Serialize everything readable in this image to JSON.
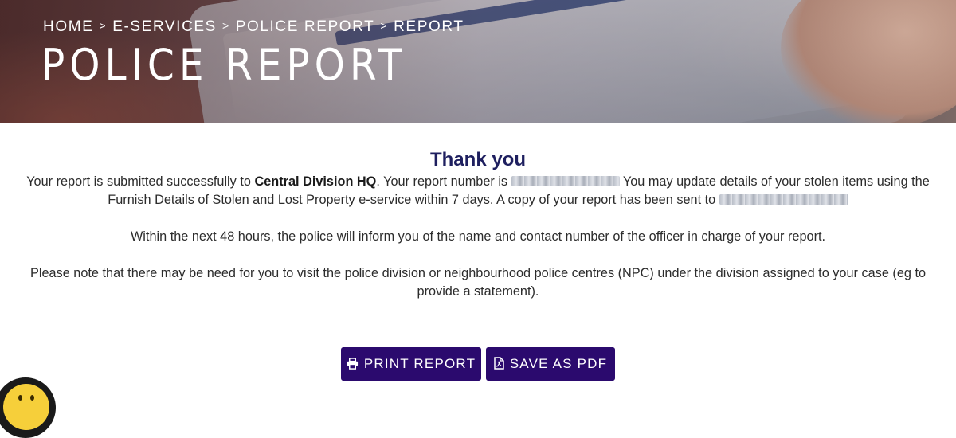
{
  "hero": {
    "breadcrumb": [
      {
        "label": "HOME"
      },
      {
        "label": "E-SERVICES"
      },
      {
        "label": "POLICE REPORT"
      },
      {
        "label": "REPORT"
      }
    ],
    "separator": ">",
    "title": "POLICE REPORT"
  },
  "confirmation": {
    "heading": "Thank you",
    "p1": {
      "lead": "Your report is submitted successfully to ",
      "division": "Central Division HQ",
      "mid": ". Your report number is ",
      "after_number": " You may update details of your stolen items using the Furnish Details of Stolen and Lost Property e-service within 7 days. A copy of your report has been sent to "
    },
    "p2": "Within the next 48 hours, the police will inform you of the name and contact number of the officer in charge of your report.",
    "p3": "Please note that there may be need for you to visit the police division or neighbourhood police centres (NPC) under the division assigned to your case (eg to provide a statement)."
  },
  "actions": {
    "print_label": "PRINT REPORT",
    "pdf_label": "SAVE AS PDF"
  },
  "colors": {
    "heading": "#1e1f5f",
    "button_bg": "#2b0a6e",
    "button_text": "#ffffff",
    "chat_widget": "#f6cf3a"
  },
  "icons": {
    "print": "printer-icon",
    "pdf": "pdf-file-icon",
    "chat": "chat-bot-icon"
  }
}
